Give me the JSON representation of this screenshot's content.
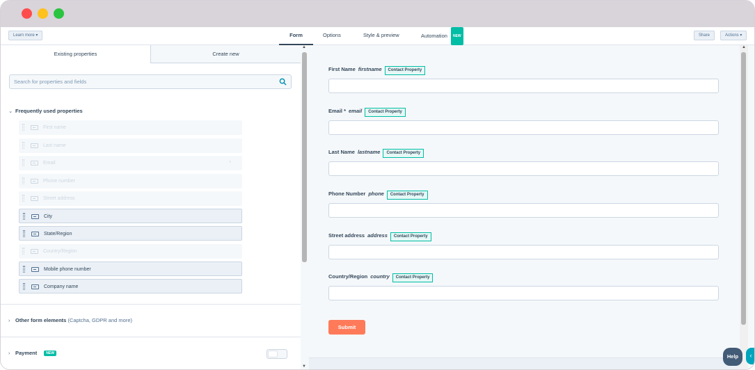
{
  "topnav": {
    "learn_more": "Learn more ▾",
    "tabs": [
      "Form",
      "Options",
      "Style & preview",
      "Automation"
    ],
    "new_badge": "NEW",
    "share": "Share",
    "actions": "Actions ▾"
  },
  "left": {
    "tabs": [
      "Existing properties",
      "Create new"
    ],
    "search_placeholder": "Search for properties and fields",
    "frequent_title": "Frequently used properties",
    "properties": [
      {
        "label": "First name",
        "in_form": true
      },
      {
        "label": "Last name",
        "in_form": true
      },
      {
        "label": "Email",
        "in_form": true,
        "required_mark": "*"
      },
      {
        "label": "Phone number",
        "in_form": true
      },
      {
        "label": "Street address",
        "in_form": true
      },
      {
        "label": "City",
        "in_form": false
      },
      {
        "label": "State/Region",
        "in_form": false
      },
      {
        "label": "Country/Region",
        "in_form": true
      },
      {
        "label": "Mobile phone number",
        "in_form": false
      },
      {
        "label": "Company name",
        "in_form": false
      }
    ],
    "other_title": "Other form elements",
    "other_note": "(Captcha, GDPR and more)",
    "payment_title": "Payment",
    "payment_badge": "NEW"
  },
  "form": {
    "fields": [
      {
        "label": "First Name",
        "internal": "firstname",
        "badge": "Contact Property"
      },
      {
        "label": "Email *",
        "internal": "email",
        "badge": "Contact Property"
      },
      {
        "label": "Last Name",
        "internal": "lastname",
        "badge": "Contact Property"
      },
      {
        "label": "Phone Number",
        "internal": "phone",
        "badge": "Contact Property"
      },
      {
        "label": "Street address",
        "internal": "address",
        "badge": "Contact Property"
      },
      {
        "label": "Country/Region",
        "internal": "country",
        "badge": "Contact Property"
      }
    ],
    "submit": "Submit"
  },
  "help": "Help",
  "colors": {
    "accent": "#00bda5",
    "submit": "#ff7a59",
    "text": "#33475b"
  }
}
